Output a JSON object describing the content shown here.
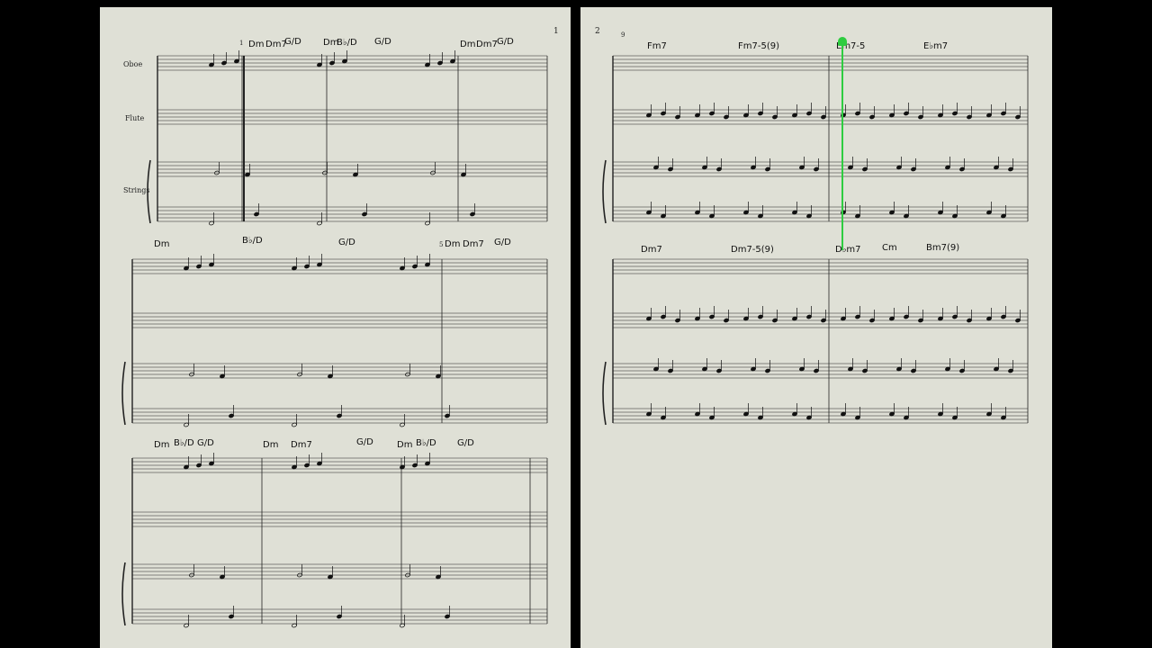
{
  "page1": {
    "number": "1",
    "instruments": {
      "oboe": "Oboe",
      "flute": "Flute",
      "strings": "Strings"
    },
    "chords_sys1": [
      "Dm",
      "Dm7",
      "G/D",
      "Dm",
      "B♭/D",
      "G/D",
      "Dm",
      "Dm7",
      "G/D"
    ],
    "chords_sys2": [
      "Dm",
      "B♭/D",
      "G/D",
      "Dm",
      "Dm7",
      "G/D"
    ],
    "chords_sys3": [
      "Dm",
      "B♭/D",
      "G/D",
      "Dm",
      "Dm7",
      "G/D",
      "Dm",
      "B♭/D",
      "G/D"
    ],
    "measure_numbers": [
      "1",
      "5"
    ]
  },
  "page2": {
    "number": "2",
    "measure_number": "9",
    "chords_sys1": [
      "Fm7",
      "Fm7-5(9)",
      "Em7-5",
      "E♭m7"
    ],
    "chords_sys2": [
      "Dm7",
      "Dm7-5(9)",
      "D♭m7",
      "Cm",
      "Bm7(9)"
    ]
  },
  "colors": {
    "page": "#dfe0d6",
    "background": "#000000",
    "playhead": "#2ecc40",
    "accent_marks": "#2255cc"
  }
}
